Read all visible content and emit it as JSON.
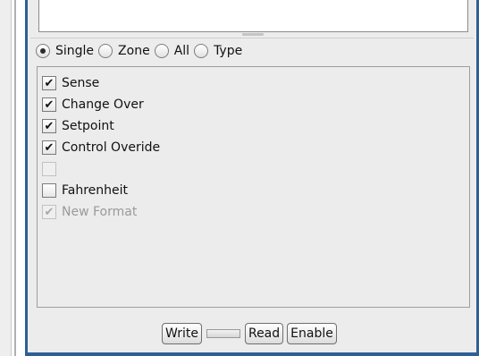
{
  "scope_options": [
    {
      "label": "Single",
      "selected": true
    },
    {
      "label": "Zone",
      "selected": false
    },
    {
      "label": "All",
      "selected": false
    },
    {
      "label": "Type",
      "selected": false
    }
  ],
  "checkboxes": [
    {
      "label": "Sense",
      "checked": true,
      "enabled": true
    },
    {
      "label": "Change Over",
      "checked": true,
      "enabled": true
    },
    {
      "label": "Setpoint",
      "checked": true,
      "enabled": true
    },
    {
      "label": "Control Overide",
      "checked": true,
      "enabled": true
    },
    {
      "label": "",
      "checked": false,
      "enabled": false
    },
    {
      "label": "Fahrenheit",
      "checked": false,
      "enabled": true
    },
    {
      "label": "New Format",
      "checked": true,
      "enabled": false
    }
  ],
  "buttons": {
    "write": "Write",
    "read": "Read",
    "enable": "Enable"
  },
  "colors": {
    "frame_border": "#2f5f93",
    "panel_background": "#ececec"
  }
}
